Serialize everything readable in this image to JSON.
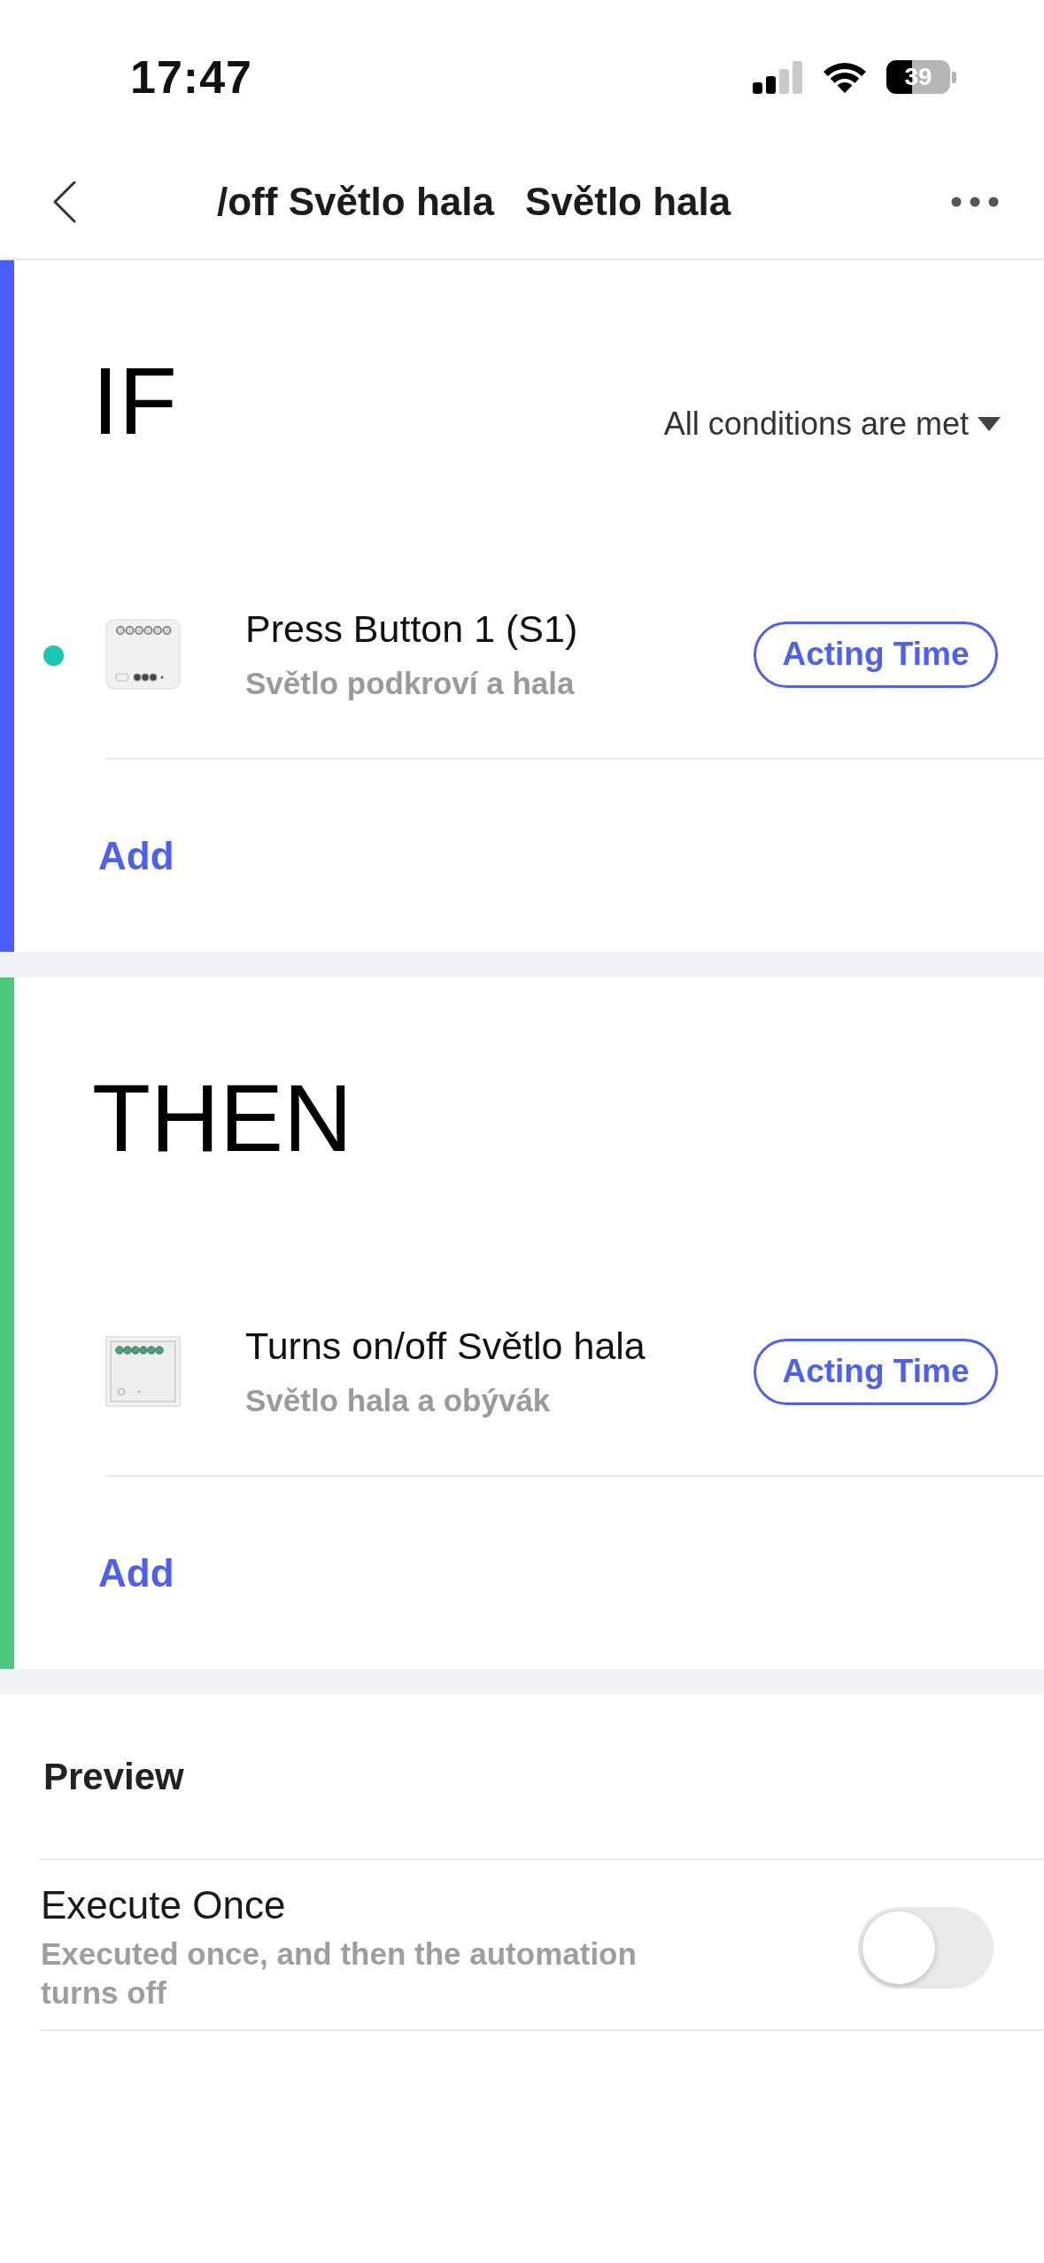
{
  "status_bar": {
    "time": "17:47",
    "battery": "39"
  },
  "nav_bar": {
    "title_segments": [
      "/off Světlo hala",
      "Světlo hala"
    ]
  },
  "sections": [
    {
      "heading": "IF",
      "color": "#4b5efc",
      "condition_mode": "All conditions are met",
      "items": [
        {
          "kind": "relay",
          "color": "#17c9b4",
          "title": "Press Button 1 (S1)",
          "subtitle": "Světlo podkroví a hala",
          "action": "Acting Time"
        }
      ],
      "add_label": "Add"
    },
    {
      "heading": "THEN",
      "color": "#4cc77e",
      "items": [
        {
          "kind": "switch",
          "title": "Turns on/off Světlo hala",
          "subtitle": "Světlo hala a obývák",
          "action": "Acting Time"
        }
      ],
      "add_label": "Add"
    }
  ],
  "preview": {
    "label": "Preview"
  },
  "settings": [
    {
      "title": "Execute Once",
      "description": "Executed once, and then the automation turns off",
      "on": false
    }
  ]
}
